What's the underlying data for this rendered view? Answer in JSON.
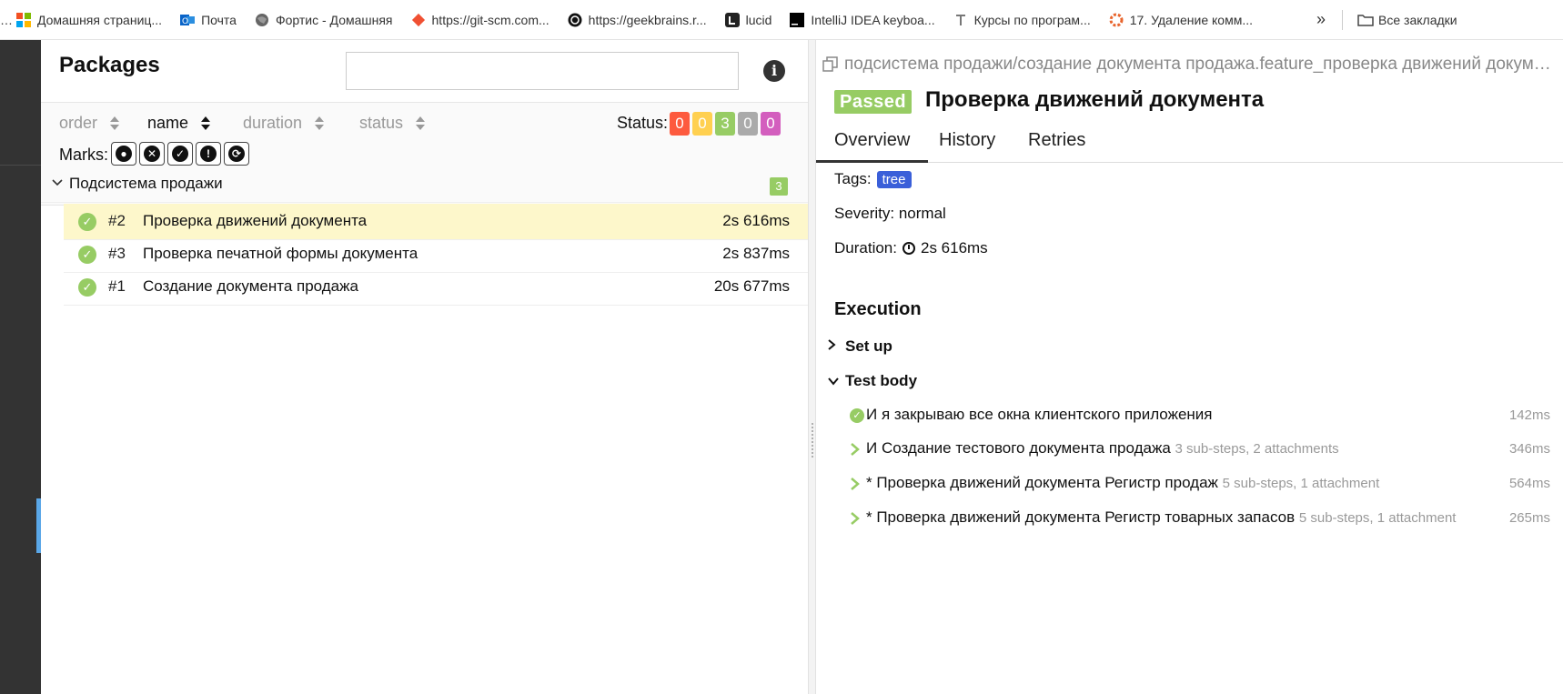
{
  "bookmarks": [
    {
      "label": "Домашняя страниц...",
      "icon": "windows-logo-icon"
    },
    {
      "label": "Почта",
      "icon": "outlook-icon"
    },
    {
      "label": "Фортис - Домашняя",
      "icon": "globe-icon"
    },
    {
      "label": "https://git-scm.com...",
      "icon": "git-icon"
    },
    {
      "label": "https://geekbrains.r...",
      "icon": "geekbrains-icon"
    },
    {
      "label": "lucid",
      "icon": "lucid-icon"
    },
    {
      "label": "IntelliJ IDEA keyboa...",
      "icon": "jetbrains-icon"
    },
    {
      "label": "Курсы по програм...",
      "icon": "bookmark-icon"
    },
    {
      "label": "17. Удаление комм...",
      "icon": "stackoverflow-icon"
    }
  ],
  "bookmarks_more": "»",
  "bookmarks_all": "Все закладки",
  "left": {
    "title": "Packages",
    "search_placeholder": "",
    "sort": [
      {
        "label": "order",
        "active": false
      },
      {
        "label": "name",
        "active": true
      },
      {
        "label": "duration",
        "active": false
      },
      {
        "label": "status",
        "active": false
      }
    ],
    "status_label": "Status:",
    "status_counts": [
      {
        "value": "0",
        "color": "#fd5a3e"
      },
      {
        "value": "0",
        "color": "#ffd050"
      },
      {
        "value": "3",
        "color": "#97cc64"
      },
      {
        "value": "0",
        "color": "#aaaaaa"
      },
      {
        "value": "0",
        "color": "#d35ebe"
      }
    ],
    "marks_label": "Marks:",
    "marks": [
      "bomb-icon",
      "close-circle-icon",
      "check-circle-icon",
      "exclamation-icon",
      "refresh-icon"
    ],
    "group": {
      "name": "Подсистема продажи",
      "count": "3"
    },
    "rows": [
      {
        "num": "#2",
        "name": "Проверка движений документа",
        "duration": "2s 616ms",
        "selected": true
      },
      {
        "num": "#3",
        "name": "Проверка печатной формы документа",
        "duration": "2s 837ms",
        "selected": false
      },
      {
        "num": "#1",
        "name": "Создание документа продажа",
        "duration": "20s 677ms",
        "selected": false
      }
    ]
  },
  "right": {
    "breadcrumb": "подсистема продажи/создание документа продажа.feature_проверка движений документа",
    "status_badge": "Passed",
    "title": "Проверка движений документа",
    "tabs": [
      "Overview",
      "History",
      "Retries"
    ],
    "tags_label": "Tags:",
    "tag": "tree",
    "severity": "Severity: normal",
    "duration_label": "Duration:",
    "duration": "2s 616ms",
    "execution_heading": "Execution",
    "setup_label": "Set up",
    "testbody_label": "Test body",
    "steps": [
      {
        "name": "И я закрываю все окна клиентского приложения",
        "meta": "",
        "duration": "142ms",
        "kind": "ok"
      },
      {
        "name": "И Создание тестового документа продажа",
        "meta": "3 sub-steps, 2 attachments",
        "duration": "346ms",
        "kind": "arrow"
      },
      {
        "name": "* Проверка движений документа Регистр продаж",
        "meta": "5 sub-steps, 1 attachment",
        "duration": "564ms",
        "kind": "arrow"
      },
      {
        "name": "* Проверка движений документа Регистр товарных запасов",
        "meta": "5 sub-steps, 1 attachment",
        "duration": "265ms",
        "kind": "arrow"
      }
    ]
  },
  "colors": {
    "passed": "#97cc64",
    "tag": "#3a5fd9",
    "selected_row": "#fdf7cb"
  }
}
